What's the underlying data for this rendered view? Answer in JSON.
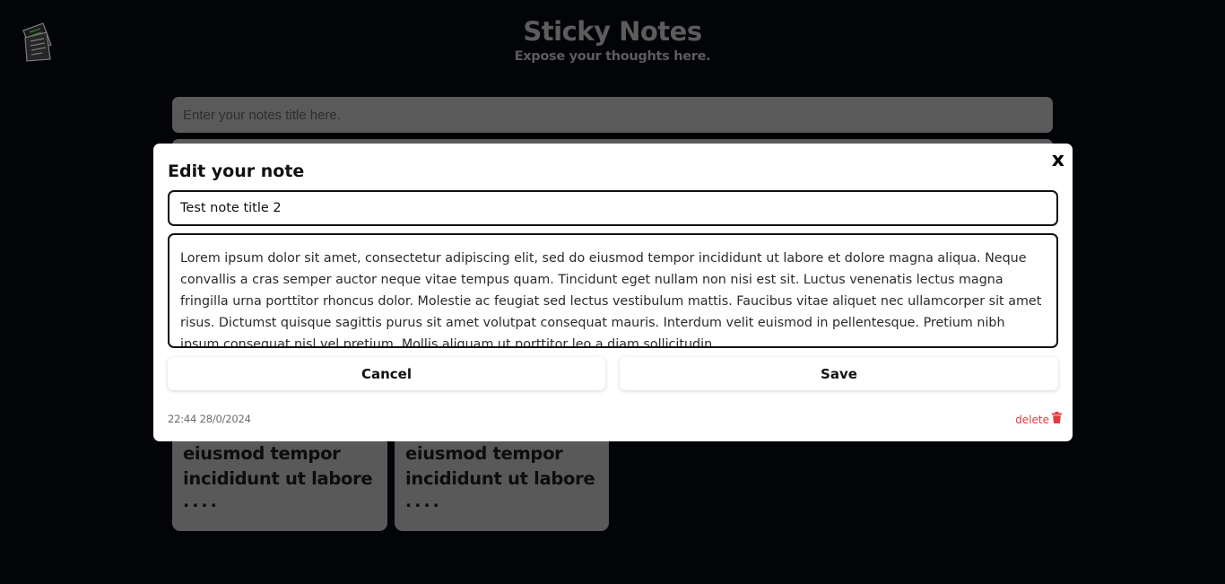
{
  "header": {
    "title": "Sticky Notes",
    "subtitle": "Expose your thoughts here."
  },
  "logo": {
    "icon": "notes-logo-icon"
  },
  "new_note": {
    "title_placeholder": "Enter your notes title here."
  },
  "notes": [
    {
      "excerpt": "eiusmod tempor incididunt ut labore",
      "ellipsis": "...."
    },
    {
      "excerpt": "eiusmod tempor incididunt ut labore",
      "ellipsis": "...."
    }
  ],
  "modal": {
    "heading": "Edit your note",
    "close_label": "x",
    "title_value": "Test note title 2",
    "body_value": "Lorem ipsum dolor sit amet, consectetur adipiscing elit, sed do eiusmod tempor incididunt ut labore et dolore magna aliqua. Neque convallis a cras semper auctor neque vitae tempus quam. Tincidunt eget nullam non nisi est sit. Luctus venenatis lectus magna fringilla urna porttitor rhoncus dolor. Molestie ac feugiat sed lectus vestibulum mattis. Faucibus vitae aliquet nec ullamcorper sit amet risus. Dictumst quisque sagittis purus sit amet volutpat consequat mauris. Interdum velit euismod in pellentesque. Pretium nibh ipsum consequat nisl vel pretium. Mollis aliquam ut porttitor leo a diam sollicitudin.",
    "cancel_label": "Cancel",
    "save_label": "Save",
    "timestamp": "22:44 28/0/2024",
    "delete_label": "delete",
    "delete_icon": "trash-icon"
  },
  "colors": {
    "background": "#030408",
    "muted_panel": "#5a5a5a",
    "delete_red": "#e33b3b"
  }
}
